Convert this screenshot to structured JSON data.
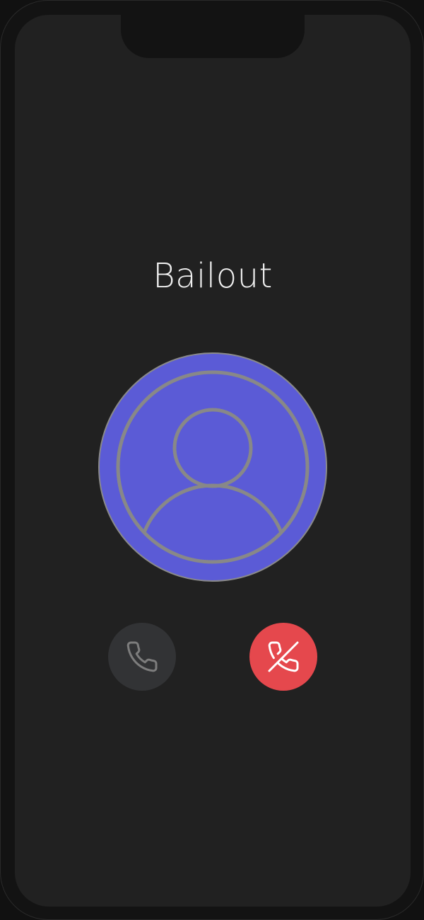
{
  "call": {
    "caller_name": "Bailout"
  },
  "avatar": {
    "icon": "user-circle-icon",
    "background_color": "#5b5bd6",
    "stroke_color": "#888888"
  },
  "actions": {
    "accept": {
      "icon": "phone-icon",
      "background_color": "#323335",
      "icon_color": "#7d7d7d"
    },
    "decline": {
      "icon": "phone-off-icon",
      "background_color": "#e5484d",
      "icon_color": "#ffffff"
    }
  },
  "colors": {
    "screen_background": "#212121",
    "frame_background": "#131313",
    "text": "#f0f0f0"
  }
}
